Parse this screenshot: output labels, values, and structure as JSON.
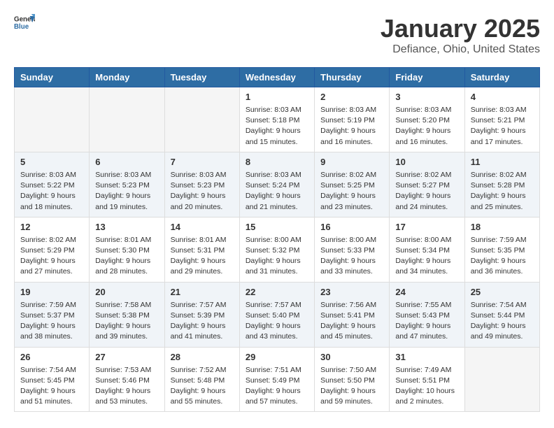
{
  "header": {
    "logo_general": "General",
    "logo_blue": "Blue",
    "month": "January 2025",
    "location": "Defiance, Ohio, United States"
  },
  "weekdays": [
    "Sunday",
    "Monday",
    "Tuesday",
    "Wednesday",
    "Thursday",
    "Friday",
    "Saturday"
  ],
  "weeks": [
    [
      {
        "day": "",
        "info": ""
      },
      {
        "day": "",
        "info": ""
      },
      {
        "day": "",
        "info": ""
      },
      {
        "day": "1",
        "info": "Sunrise: 8:03 AM\nSunset: 5:18 PM\nDaylight: 9 hours\nand 15 minutes."
      },
      {
        "day": "2",
        "info": "Sunrise: 8:03 AM\nSunset: 5:19 PM\nDaylight: 9 hours\nand 16 minutes."
      },
      {
        "day": "3",
        "info": "Sunrise: 8:03 AM\nSunset: 5:20 PM\nDaylight: 9 hours\nand 16 minutes."
      },
      {
        "day": "4",
        "info": "Sunrise: 8:03 AM\nSunset: 5:21 PM\nDaylight: 9 hours\nand 17 minutes."
      }
    ],
    [
      {
        "day": "5",
        "info": "Sunrise: 8:03 AM\nSunset: 5:22 PM\nDaylight: 9 hours\nand 18 minutes."
      },
      {
        "day": "6",
        "info": "Sunrise: 8:03 AM\nSunset: 5:23 PM\nDaylight: 9 hours\nand 19 minutes."
      },
      {
        "day": "7",
        "info": "Sunrise: 8:03 AM\nSunset: 5:23 PM\nDaylight: 9 hours\nand 20 minutes."
      },
      {
        "day": "8",
        "info": "Sunrise: 8:03 AM\nSunset: 5:24 PM\nDaylight: 9 hours\nand 21 minutes."
      },
      {
        "day": "9",
        "info": "Sunrise: 8:02 AM\nSunset: 5:25 PM\nDaylight: 9 hours\nand 23 minutes."
      },
      {
        "day": "10",
        "info": "Sunrise: 8:02 AM\nSunset: 5:27 PM\nDaylight: 9 hours\nand 24 minutes."
      },
      {
        "day": "11",
        "info": "Sunrise: 8:02 AM\nSunset: 5:28 PM\nDaylight: 9 hours\nand 25 minutes."
      }
    ],
    [
      {
        "day": "12",
        "info": "Sunrise: 8:02 AM\nSunset: 5:29 PM\nDaylight: 9 hours\nand 27 minutes."
      },
      {
        "day": "13",
        "info": "Sunrise: 8:01 AM\nSunset: 5:30 PM\nDaylight: 9 hours\nand 28 minutes."
      },
      {
        "day": "14",
        "info": "Sunrise: 8:01 AM\nSunset: 5:31 PM\nDaylight: 9 hours\nand 29 minutes."
      },
      {
        "day": "15",
        "info": "Sunrise: 8:00 AM\nSunset: 5:32 PM\nDaylight: 9 hours\nand 31 minutes."
      },
      {
        "day": "16",
        "info": "Sunrise: 8:00 AM\nSunset: 5:33 PM\nDaylight: 9 hours\nand 33 minutes."
      },
      {
        "day": "17",
        "info": "Sunrise: 8:00 AM\nSunset: 5:34 PM\nDaylight: 9 hours\nand 34 minutes."
      },
      {
        "day": "18",
        "info": "Sunrise: 7:59 AM\nSunset: 5:35 PM\nDaylight: 9 hours\nand 36 minutes."
      }
    ],
    [
      {
        "day": "19",
        "info": "Sunrise: 7:59 AM\nSunset: 5:37 PM\nDaylight: 9 hours\nand 38 minutes."
      },
      {
        "day": "20",
        "info": "Sunrise: 7:58 AM\nSunset: 5:38 PM\nDaylight: 9 hours\nand 39 minutes."
      },
      {
        "day": "21",
        "info": "Sunrise: 7:57 AM\nSunset: 5:39 PM\nDaylight: 9 hours\nand 41 minutes."
      },
      {
        "day": "22",
        "info": "Sunrise: 7:57 AM\nSunset: 5:40 PM\nDaylight: 9 hours\nand 43 minutes."
      },
      {
        "day": "23",
        "info": "Sunrise: 7:56 AM\nSunset: 5:41 PM\nDaylight: 9 hours\nand 45 minutes."
      },
      {
        "day": "24",
        "info": "Sunrise: 7:55 AM\nSunset: 5:43 PM\nDaylight: 9 hours\nand 47 minutes."
      },
      {
        "day": "25",
        "info": "Sunrise: 7:54 AM\nSunset: 5:44 PM\nDaylight: 9 hours\nand 49 minutes."
      }
    ],
    [
      {
        "day": "26",
        "info": "Sunrise: 7:54 AM\nSunset: 5:45 PM\nDaylight: 9 hours\nand 51 minutes."
      },
      {
        "day": "27",
        "info": "Sunrise: 7:53 AM\nSunset: 5:46 PM\nDaylight: 9 hours\nand 53 minutes."
      },
      {
        "day": "28",
        "info": "Sunrise: 7:52 AM\nSunset: 5:48 PM\nDaylight: 9 hours\nand 55 minutes."
      },
      {
        "day": "29",
        "info": "Sunrise: 7:51 AM\nSunset: 5:49 PM\nDaylight: 9 hours\nand 57 minutes."
      },
      {
        "day": "30",
        "info": "Sunrise: 7:50 AM\nSunset: 5:50 PM\nDaylight: 9 hours\nand 59 minutes."
      },
      {
        "day": "31",
        "info": "Sunrise: 7:49 AM\nSunset: 5:51 PM\nDaylight: 10 hours\nand 2 minutes."
      },
      {
        "day": "",
        "info": ""
      }
    ]
  ]
}
